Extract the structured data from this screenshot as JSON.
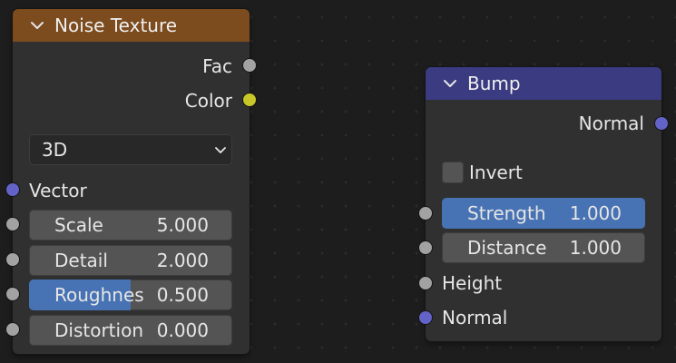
{
  "nodes": {
    "noise_texture": {
      "title": "Noise Texture",
      "header_color": "#7c4b1e",
      "outputs": [
        {
          "label": "Fac",
          "socket_color": "#a2a2a2"
        },
        {
          "label": "Color",
          "socket_color": "#c7c729"
        }
      ],
      "dimensions": {
        "selected": "3D"
      },
      "vector_input": {
        "label": "Vector",
        "socket_color": "#6363c7"
      },
      "inputs": [
        {
          "label": "Scale",
          "value": "5.000"
        },
        {
          "label": "Detail",
          "value": "2.000"
        },
        {
          "label": "Roughnes",
          "value": "0.500",
          "fill_fraction": 0.5
        },
        {
          "label": "Distortion",
          "value": "0.000"
        }
      ]
    },
    "bump": {
      "title": "Bump",
      "header_color": "#3b3b82",
      "output": {
        "label": "Normal",
        "socket_color": "#6363c7"
      },
      "invert": {
        "label": "Invert",
        "checked": false
      },
      "inputs": [
        {
          "label": "Strength",
          "value": "1.000",
          "fill_fraction": 1.0
        },
        {
          "label": "Distance",
          "value": "1.000"
        }
      ],
      "height_input": {
        "label": "Height"
      },
      "normal_input": {
        "label": "Normal"
      }
    }
  },
  "colors": {
    "accent_blue": "#4772b3",
    "field_bg": "#545454",
    "node_bg": "#303030",
    "canvas_bg": "#1d1d1d"
  }
}
